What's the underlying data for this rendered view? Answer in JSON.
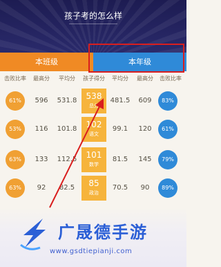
{
  "header": {
    "title": "孩子考的怎么样"
  },
  "tabs": {
    "class_label": "本班级",
    "grade_label": "本年级"
  },
  "columns": [
    "击败比率",
    "最高分",
    "平均分",
    "孩子得分",
    "平均分",
    "最高分",
    "击败比率"
  ],
  "rows": [
    {
      "class_beat": "61%",
      "class_max": "596",
      "class_avg": "531.8",
      "child_score": "538",
      "child_subject": "总分",
      "grade_avg": "481.5",
      "grade_max": "609",
      "grade_beat": "83%"
    },
    {
      "class_beat": "53%",
      "class_max": "116",
      "class_avg": "101.8",
      "child_score": "102",
      "child_subject": "语文",
      "grade_avg": "99.1",
      "grade_max": "120",
      "grade_beat": "61%"
    },
    {
      "class_beat": "63%",
      "class_max": "133",
      "class_avg": "112.5",
      "child_score": "101",
      "child_subject": "数学",
      "grade_avg": "81.5",
      "grade_max": "145",
      "grade_beat": "79%"
    },
    {
      "class_beat": "63%",
      "class_max": "92",
      "class_avg": "82.5",
      "child_score": "85",
      "child_subject": "政治",
      "grade_avg": "70.5",
      "grade_max": "90",
      "grade_beat": "89%"
    }
  ],
  "colors": {
    "orange": "#f08a24",
    "blue": "#2f8ad8",
    "highlight": "#d91e1e",
    "header": "#1d1c52"
  },
  "watermark": {
    "name": "广晟德手游",
    "url": "www.gsdtiepianji.com"
  }
}
